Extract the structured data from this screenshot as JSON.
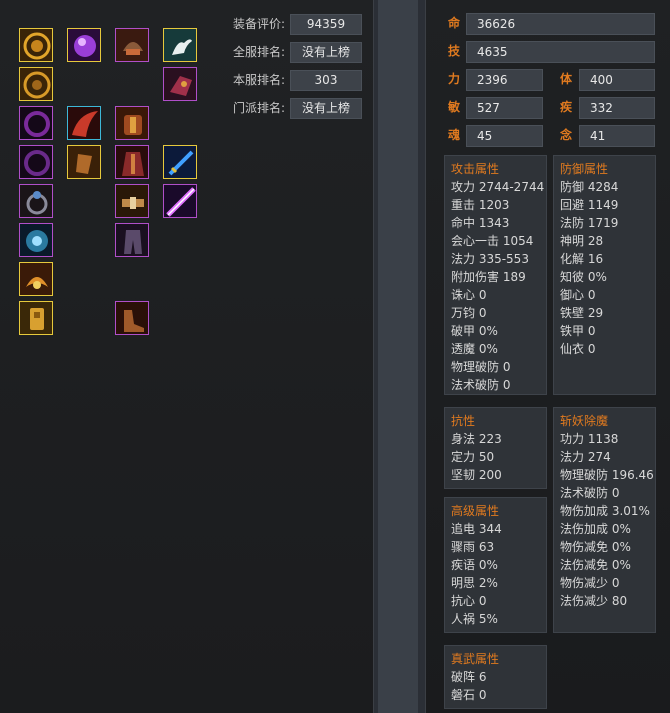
{
  "ranks": [
    {
      "label": "装备评价:",
      "value": "94359"
    },
    {
      "label": "全服排名:",
      "value": "没有上榜"
    },
    {
      "label": "本服排名:",
      "value": "303"
    },
    {
      "label": "门派排名:",
      "value": "没有上榜"
    }
  ],
  "stats": {
    "ming": {
      "key": "命",
      "value": "36626"
    },
    "ji": {
      "key": "技",
      "value": "4635"
    },
    "li": {
      "key": "力",
      "value": "2396"
    },
    "ti": {
      "key": "体",
      "value": "400"
    },
    "min": {
      "key": "敏",
      "value": "527"
    },
    "ji2": {
      "key": "疾",
      "value": "332"
    },
    "hun": {
      "key": "魂",
      "value": "45"
    },
    "nian": {
      "key": "念",
      "value": "41"
    }
  },
  "attack": {
    "title": "攻击属性",
    "lines": [
      "攻力 2744-2744",
      "重击 1203",
      "命中 1343",
      "会心一击 1054",
      "法力 335-553",
      "附加伤害 189",
      "诛心 0",
      "万钧 0",
      "破甲 0%",
      "透魔 0%",
      "物理破防 0",
      "法术破防 0"
    ]
  },
  "defense": {
    "title": "防御属性",
    "lines": [
      "防御 4284",
      "回避 1149",
      "法防 1719",
      "神明 28",
      "化解 16",
      "知彼 0%",
      "御心 0",
      "铁壁 29",
      "铁甲 0",
      "仙衣 0"
    ]
  },
  "resist": {
    "title": "抗性",
    "lines": [
      "身法 223",
      "定力 50",
      "坚韧 200"
    ]
  },
  "demon": {
    "title": "斩妖除魔",
    "lines": [
      "功力 1138",
      "法力 274",
      "物理破防 196.46",
      "法术破防 0",
      "物伤加成 3.01%",
      "法伤加成 0%",
      "物伤减免 0%",
      "法伤减免 0%",
      "物伤减少 0",
      "法伤减少 80"
    ]
  },
  "advanced": {
    "title": "高级属性",
    "lines": [
      "追电 344",
      "骤雨 63",
      "疾语 0%",
      "明思 2%",
      "抗心 0",
      "人祸 5%"
    ]
  },
  "martial": {
    "title": "真武属性",
    "lines": [
      "破阵 6",
      "磐石 0"
    ]
  },
  "slots": [
    {
      "name": "gold-amulet-icon",
      "tier": "gold"
    },
    {
      "name": "purple-orb-icon",
      "tier": "gold"
    },
    {
      "name": "helmet-icon",
      "tier": "purple"
    },
    {
      "name": "white-crane-icon",
      "tier": "gold"
    },
    {
      "name": "gold-medallion-icon",
      "tier": "gold"
    },
    {
      "name": "boots-icon",
      "tier": "purple"
    },
    {
      "name": "dark-ring-icon",
      "tier": "purple"
    },
    {
      "name": "red-wings-icon",
      "tier": "blue"
    },
    {
      "name": "chest-armor-icon",
      "tier": "purple"
    },
    {
      "name": "dark-ring-2-icon",
      "tier": "purple"
    },
    {
      "name": "bracer-icon",
      "tier": "gold"
    },
    {
      "name": "robe-icon",
      "tier": "purple"
    },
    {
      "name": "sword-icon",
      "tier": "gold"
    },
    {
      "name": "ring-gem-icon",
      "tier": "purple"
    },
    {
      "name": "belt-icon",
      "tier": "purple"
    },
    {
      "name": "purple-blade-icon",
      "tier": "purple"
    },
    {
      "name": "blue-ring-icon",
      "tier": "purple"
    },
    {
      "name": "pants-icon",
      "tier": "purple"
    },
    {
      "name": "phoenix-icon",
      "tier": "gold"
    },
    {
      "name": "golden-idol-icon",
      "tier": "gold"
    },
    {
      "name": "shoes-icon",
      "tier": "purple"
    }
  ]
}
